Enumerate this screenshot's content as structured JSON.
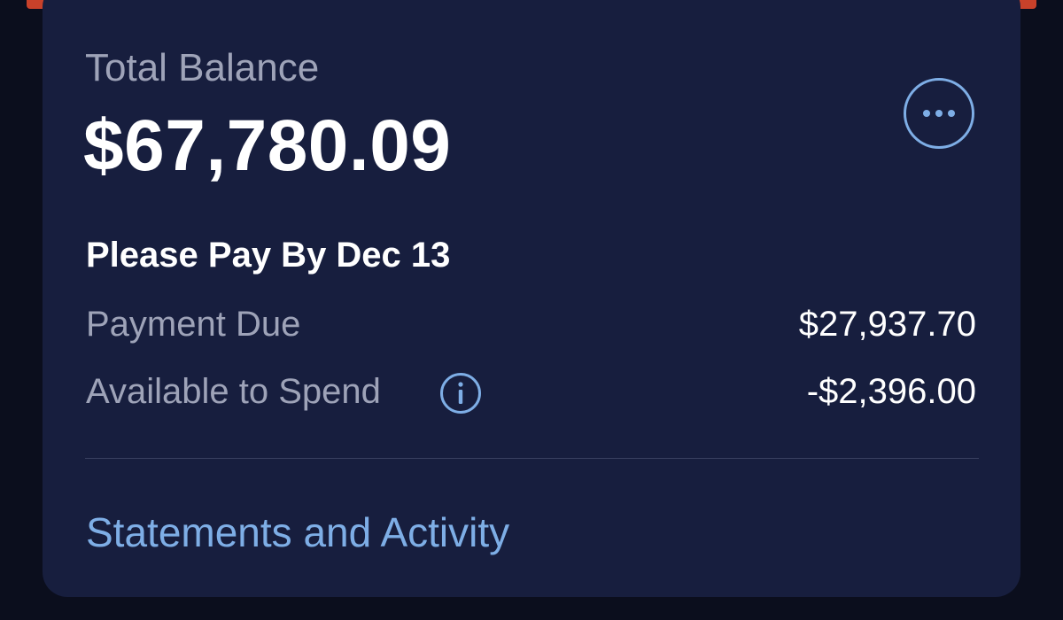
{
  "card": {
    "balance_label": "Total Balance",
    "balance_amount": "$67,780.09",
    "more_icon": "ellipsis-circle-icon",
    "pay_by": "Please Pay By Dec 13",
    "payment_due": {
      "label": "Payment Due",
      "value": "$27,937.70"
    },
    "available": {
      "label": "Available to Spend",
      "value": "-$2,396.00",
      "info_icon": "info-circle-icon"
    },
    "statements_link": "Statements and Activity"
  },
  "colors": {
    "background": "#0b0e1d",
    "card": "#171e3e",
    "accent": "#7eaee6",
    "label": "#9ea3b8",
    "value": "#ffffff",
    "top_accent": "#c8412a"
  }
}
